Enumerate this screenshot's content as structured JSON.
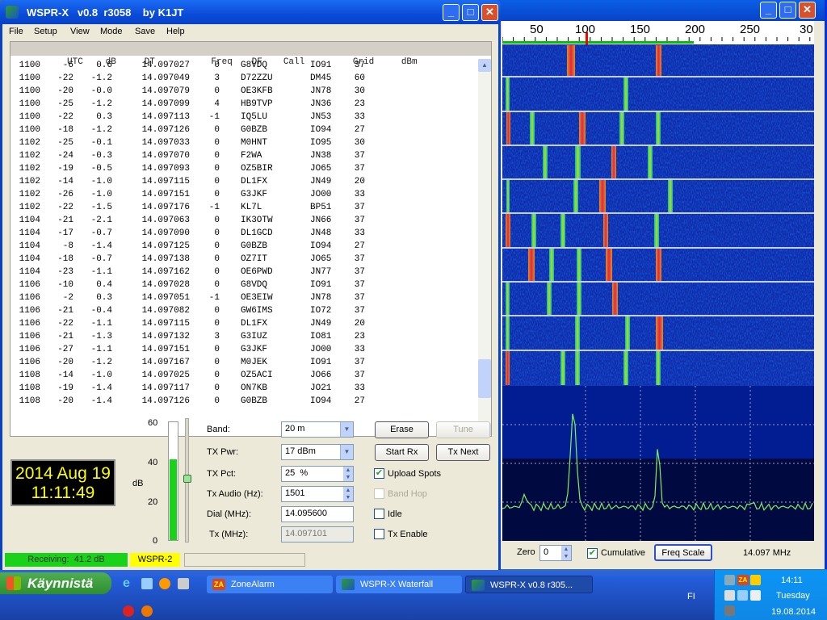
{
  "waterfall": {
    "scale": [
      "50",
      "100",
      "150",
      "200",
      "250",
      "30"
    ],
    "zero_label": "Zero",
    "zero_value": "0",
    "cumulative_label": "Cumulative",
    "cumulative_checked": true,
    "freq_scale_label": "Freq Scale",
    "freq_readout": "14.097 MHz"
  },
  "main": {
    "title": "WSPR-X   v0.8  r3058    by K1JT",
    "menu": [
      "File",
      "Setup",
      "View",
      "Mode",
      "Save",
      "Help"
    ],
    "headers": [
      "UTC",
      "dB",
      "DT",
      "Freq",
      "DF",
      "Call",
      "Grid",
      "dBm"
    ],
    "rows": [
      [
        "1100",
        "-6",
        "0.6",
        "14.097027",
        "0",
        "G8VDQ",
        "IO91",
        "37"
      ],
      [
        "1100",
        "-22",
        "-1.2",
        "14.097049",
        "3",
        "D72ZZU",
        "DM45",
        "60"
      ],
      [
        "1100",
        "-20",
        "-0.0",
        "14.097079",
        "0",
        "OE3KFB",
        "JN78",
        "30"
      ],
      [
        "1100",
        "-25",
        "-1.2",
        "14.097099",
        "4",
        "HB9TVP",
        "JN36",
        "23"
      ],
      [
        "1100",
        "-22",
        "0.3",
        "14.097113",
        "-1",
        "IQ5LU",
        "JN53",
        "33"
      ],
      [
        "1100",
        "-18",
        "-1.2",
        "14.097126",
        "0",
        "G0BZB",
        "IO94",
        "27"
      ],
      [
        "1102",
        "-25",
        "-0.1",
        "14.097033",
        "0",
        "M0HNT",
        "IO95",
        "30"
      ],
      [
        "1102",
        "-24",
        "-0.3",
        "14.097070",
        "0",
        "F2WA",
        "JN38",
        "37"
      ],
      [
        "1102",
        "-19",
        "-0.5",
        "14.097093",
        "0",
        "OZ5BIR",
        "JO65",
        "37"
      ],
      [
        "1102",
        "-14",
        "-1.0",
        "14.097115",
        "0",
        "DL1FX",
        "JN49",
        "20"
      ],
      [
        "1102",
        "-26",
        "-1.0",
        "14.097151",
        "0",
        "G3JKF",
        "JO00",
        "33"
      ],
      [
        "1102",
        "-22",
        "-1.5",
        "14.097176",
        "-1",
        "KL7L",
        "BP51",
        "37"
      ],
      [
        "1104",
        "-21",
        "-2.1",
        "14.097063",
        "0",
        "IK3OTW",
        "JN66",
        "37"
      ],
      [
        "1104",
        "-17",
        "-0.7",
        "14.097090",
        "0",
        "DL1GCD",
        "JN48",
        "33"
      ],
      [
        "1104",
        "-8",
        "-1.4",
        "14.097125",
        "0",
        "G0BZB",
        "IO94",
        "27"
      ],
      [
        "1104",
        "-18",
        "-0.7",
        "14.097138",
        "0",
        "OZ7IT",
        "JO65",
        "37"
      ],
      [
        "1104",
        "-23",
        "-1.1",
        "14.097162",
        "0",
        "OE6PWD",
        "JN77",
        "37"
      ],
      [
        "1106",
        "-10",
        "0.4",
        "14.097028",
        "0",
        "G8VDQ",
        "IO91",
        "37"
      ],
      [
        "1106",
        "-2",
        "0.3",
        "14.097051",
        "-1",
        "OE3EIW",
        "JN78",
        "37"
      ],
      [
        "1106",
        "-21",
        "-0.4",
        "14.097082",
        "0",
        "GW6IMS",
        "IO72",
        "37"
      ],
      [
        "1106",
        "-22",
        "-1.1",
        "14.097115",
        "0",
        "DL1FX",
        "JN49",
        "20"
      ],
      [
        "1106",
        "-21",
        "-1.3",
        "14.097132",
        "3",
        "G3IUZ",
        "IO81",
        "23"
      ],
      [
        "1106",
        "-27",
        "-1.1",
        "14.097151",
        "0",
        "G3JKF",
        "JO00",
        "33"
      ],
      [
        "1106",
        "-20",
        "-1.2",
        "14.097167",
        "0",
        "M0JEK",
        "IO91",
        "37"
      ],
      [
        "1108",
        "-14",
        "-1.0",
        "14.097025",
        "0",
        "OZ5ACI",
        "JO66",
        "37"
      ],
      [
        "1108",
        "-19",
        "-1.4",
        "14.097117",
        "0",
        "ON7KB",
        "JO21",
        "33"
      ],
      [
        "1108",
        "-20",
        "-1.4",
        "14.097126",
        "0",
        "G0BZB",
        "IO94",
        "27"
      ]
    ],
    "meter_ticks": [
      "60",
      "40",
      "20",
      "0"
    ],
    "meter_unit": "dB",
    "meter_level_db": 41.2,
    "date": "2014 Aug 19",
    "time": "11:11:49",
    "band_label": "Band:",
    "band_value": "20 m",
    "txpwr_label": "TX Pwr:",
    "txpwr_value": "17 dBm",
    "txpct_label": "TX Pct:",
    "txpct_value": "25  %",
    "txaudio_label": "Tx Audio (Hz):",
    "txaudio_value": "1501",
    "dial_label": "Dial (MHz):",
    "dial_value": "14.095600",
    "txmhz_label": "Tx (MHz):",
    "txmhz_value": "14.097101",
    "erase": "Erase",
    "tune": "Tune",
    "start_rx": "Start Rx",
    "tx_next": "Tx Next",
    "upload_spots": "Upload Spots",
    "band_hop": "Band Hop",
    "idle": "Idle",
    "tx_enable": "Tx Enable",
    "status_receiving": "Receiving:  41.2 dB",
    "status_mode": "WSPR-2"
  },
  "taskbar": {
    "start": "Käynnistä",
    "tasks": [
      "ZoneAlarm",
      "WSPR-X Waterfall",
      "WSPR-X   v0.8  r305..."
    ],
    "lang": "FI",
    "clock": "14:11",
    "day": "Tuesday",
    "date": "19.08.2014"
  }
}
